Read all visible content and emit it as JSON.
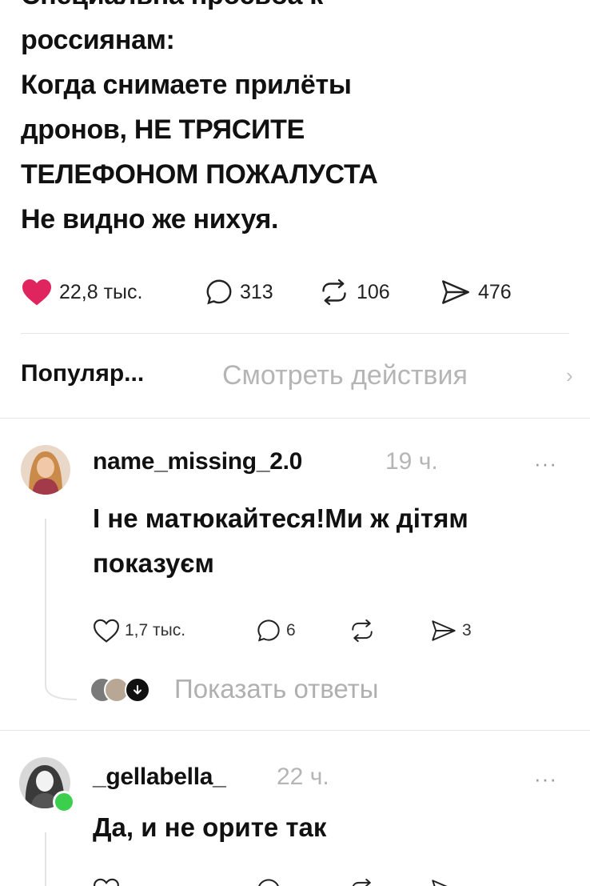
{
  "post": {
    "text_lines": [
      "Специальна просьба к",
      "россиянам:",
      "Когда снимаете прилёты",
      "дронов, НЕ ТРЯСИТЕ",
      "ТЕЛЕФОНОМ ПОЖАЛУСТА",
      "Не видно же нихуя."
    ],
    "likes": "22,8 тыс.",
    "comments": "313",
    "reposts": "106",
    "shares": "476",
    "like_color": "#e0245e"
  },
  "sort": {
    "label": "Популяр...",
    "activity_link": "Смотреть действия",
    "chevron": "›"
  },
  "comments": [
    {
      "username": "name_missing_2.0",
      "time": "19 ч.",
      "more": "···",
      "text_lines": [
        "І не матюкайтеся!Ми ж дітям",
        "показуєм"
      ],
      "likes": "1,7 тыс.",
      "comments": "6",
      "reposts": "",
      "shares": "3",
      "show_replies": "Показать ответы"
    },
    {
      "username": "_gellabella_",
      "time": "22 ч.",
      "more": "···",
      "text_lines": [
        "Да, и не орите так"
      ],
      "online_color": "#3ccf4e"
    }
  ]
}
